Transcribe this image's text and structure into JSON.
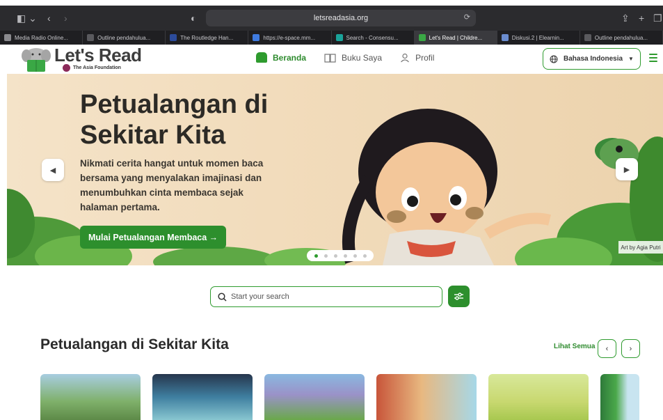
{
  "browser": {
    "url": "letsreadasia.org",
    "tabs": [
      {
        "label": "Media Radio Online...",
        "color": "#8a8a8e"
      },
      {
        "label": "Outline pendahulua...",
        "color": "#5a5a5e"
      },
      {
        "label": "The Routledge Han...",
        "color": "#2c4b9b"
      },
      {
        "label": "https://e-space.mm...",
        "color": "#3f7be0"
      },
      {
        "label": "Search - Consensu...",
        "color": "#1aa39a"
      },
      {
        "label": "Let's Read | Childre...",
        "color": "#3aa845",
        "active": true
      },
      {
        "label": "Diskusi.2 | Elearnin...",
        "color": "#6a8ccf"
      },
      {
        "label": "Outline pendahulua...",
        "color": "#5a5a5e"
      }
    ]
  },
  "header": {
    "logo_title": "Let's Read",
    "logo_subtitle": "The Asia Foundation",
    "nav": [
      {
        "label": "Beranda",
        "active": true
      },
      {
        "label": "Buku Saya"
      },
      {
        "label": "Profil"
      }
    ],
    "language": "Bahasa Indonesia"
  },
  "hero": {
    "title": "Petualangan di Sekitar Kita",
    "description": "Nikmati cerita hangat untuk momen baca bersama yang menyalakan imajinasi dan menumbuhkan cinta membaca sejak halaman pertama.",
    "cta": "Mulai Petualangan Membaca →",
    "art_credit": "Art by Agia Putri",
    "slide_count": 6,
    "active_slide": 0
  },
  "search": {
    "placeholder": "Start your search"
  },
  "section": {
    "title": "Petualangan di Sekitar Kita",
    "see_all": "Lihat Semua"
  },
  "colors": {
    "brand_green": "#2d8f2d",
    "hero_bg": "#f2dcbc"
  }
}
